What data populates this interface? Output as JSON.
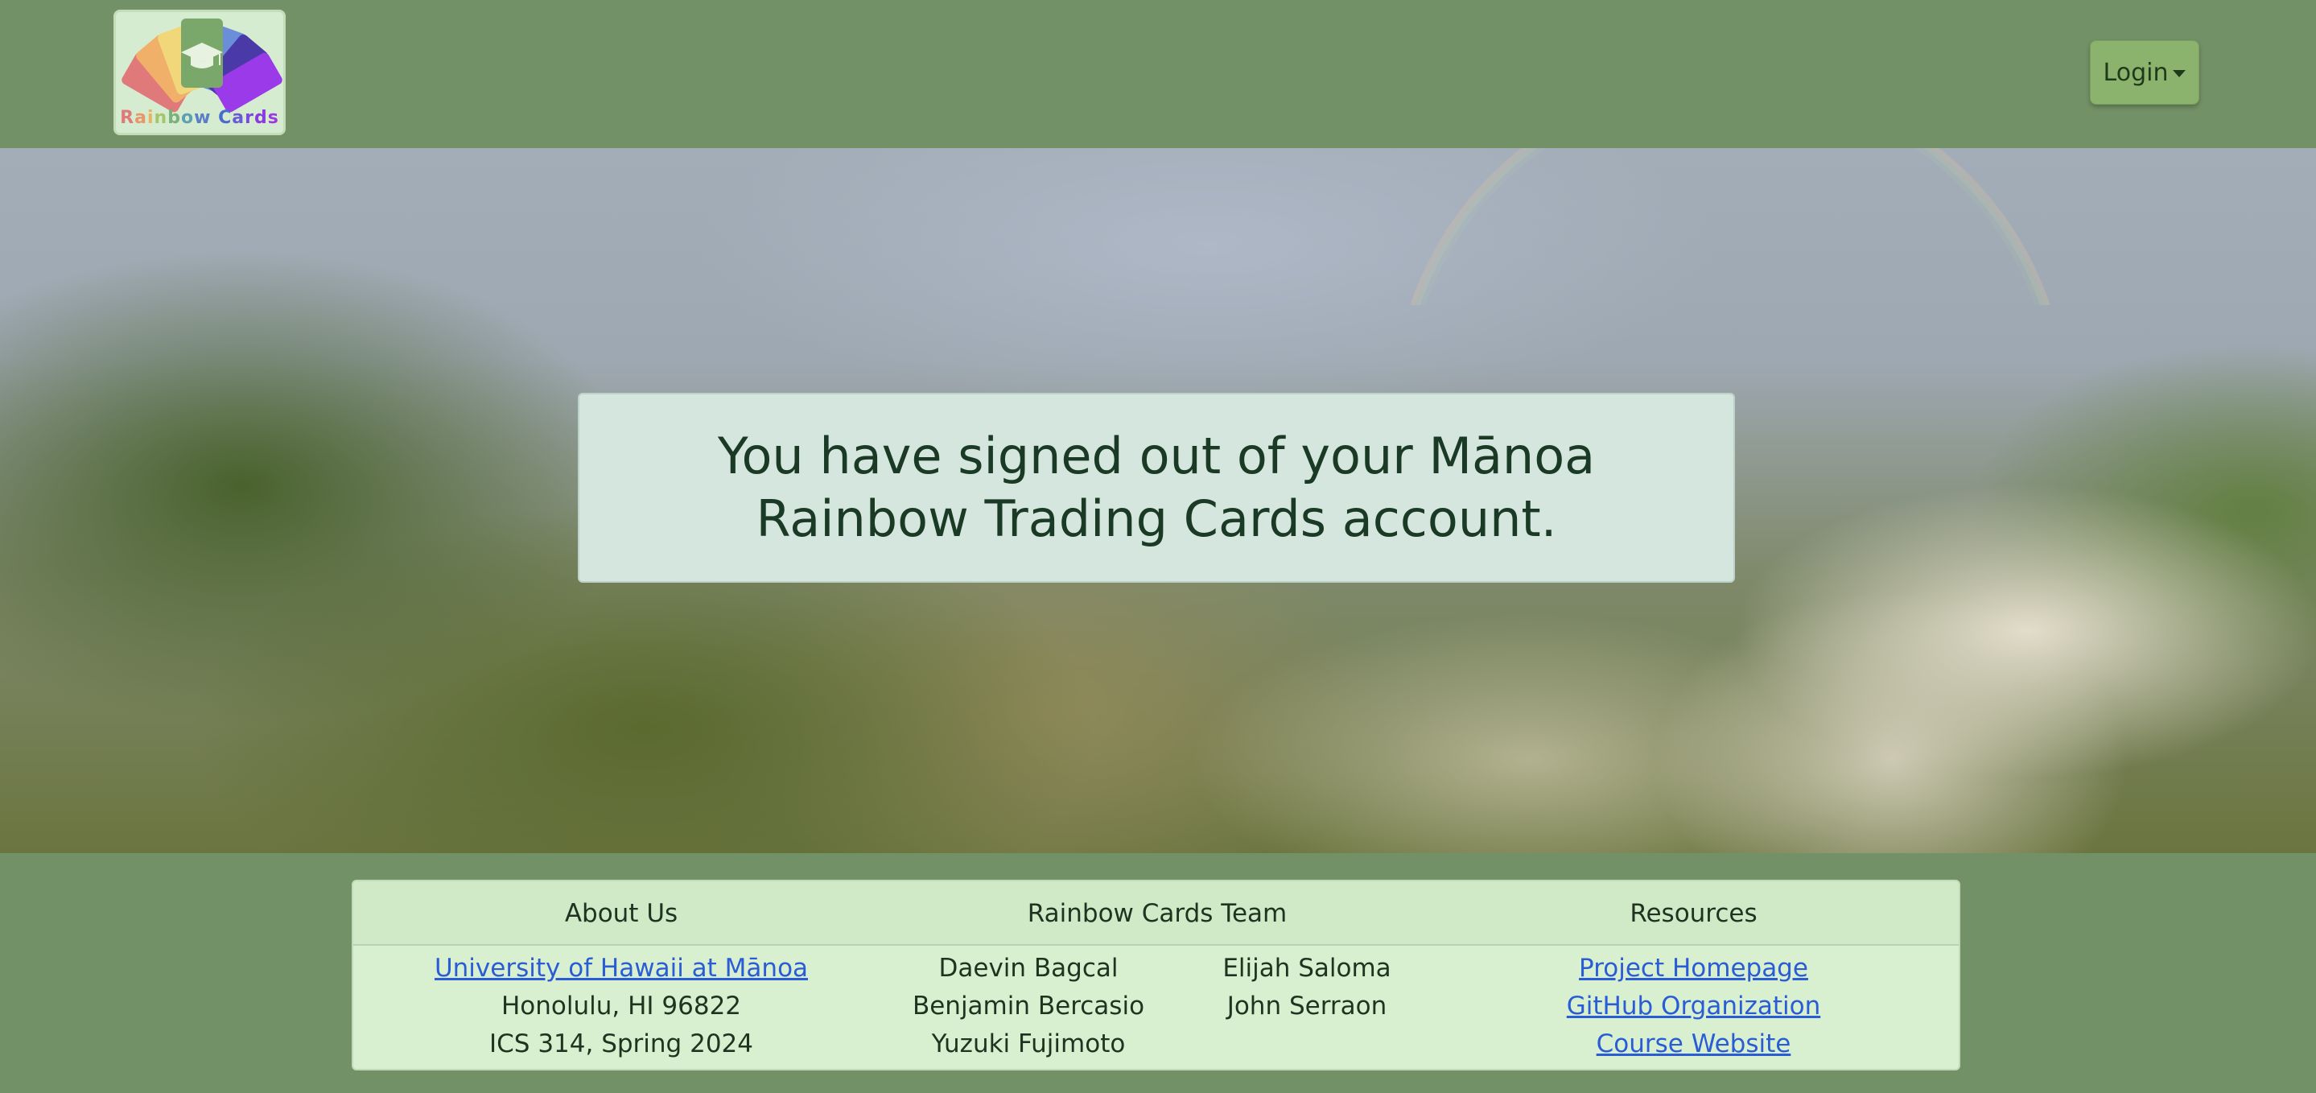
{
  "navbar": {
    "logo": {
      "text_letters": [
        "R",
        "a",
        "i",
        "n",
        "b",
        "o",
        "w",
        " ",
        "C",
        "a",
        "r",
        "d",
        "s"
      ],
      "letter_colors": [
        "#e07a7a",
        "#e8956a",
        "#e8b25e",
        "#a8c468",
        "#7ab07a",
        "#5e9fb0",
        "#5a7ec8",
        "#ffffff",
        "#4a6ad0",
        "#6a5ad8",
        "#7a4ae0",
        "#8a3ae0",
        "#9a3ae0"
      ],
      "card_colors": [
        "#e07a7a",
        "#f0b06a",
        "#f2d67a",
        "#7aa86a",
        "#6a8fd8",
        "#4a3aa8",
        "#9a3ae8"
      ],
      "icon": "graduation-cap-icon"
    },
    "login_label": "Login"
  },
  "hero": {
    "message": "You have signed out of your Mānoa Rainbow Trading Cards account."
  },
  "footer": {
    "about": {
      "heading": "About Us",
      "link": "University of Hawaii at Mānoa",
      "address": "Honolulu, HI 96822",
      "course": "ICS 314, Spring 2024"
    },
    "team": {
      "heading": "Rainbow Cards Team",
      "members_left": [
        "Daevin Bagcal",
        "Benjamin Bercasio",
        "Yuzuki Fujimoto"
      ],
      "members_right": [
        "Elijah Saloma",
        "John Serraon"
      ]
    },
    "resources": {
      "heading": "Resources",
      "links": [
        "Project Homepage",
        "GitHub Organization",
        "Course Website"
      ]
    }
  },
  "colors": {
    "page_bg": "#739166",
    "message_bg": "#d5e6df",
    "footer_card_bg": "#d9f0d0",
    "link": "#2a5cd6",
    "login_btn": "#8cb36e"
  }
}
